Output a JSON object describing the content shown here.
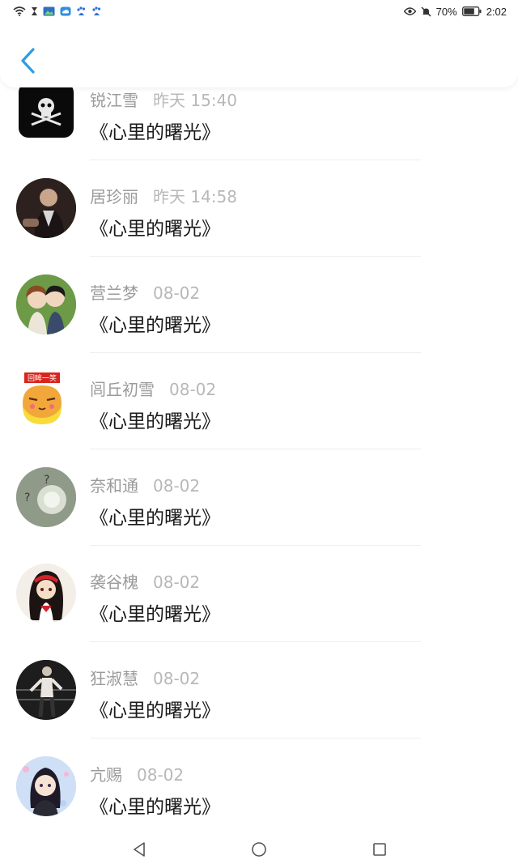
{
  "status_bar": {
    "battery_percent": "70%",
    "time": "2:02",
    "icons_left": [
      "wifi-icon",
      "hourglass-icon",
      "image-icon",
      "cloud-icon",
      "baidu-icon",
      "baidu-icon"
    ],
    "icons_right": [
      "eye-icon",
      "mute-bell-icon",
      "battery-icon"
    ]
  },
  "header": {
    "back_icon": "chevron-left-icon",
    "accent_color": "#2d9ce6"
  },
  "messages": [
    {
      "name": "锐江雪",
      "time": "昨天 15:40",
      "text": "《心里的曙光》"
    },
    {
      "name": "居珍丽",
      "time": "昨天 14:58",
      "text": "《心里的曙光》"
    },
    {
      "name": "营兰梦",
      "time": "08-02",
      "text": "《心里的曙光》"
    },
    {
      "name": "闾丘初雪",
      "time": "08-02",
      "text": "《心里的曙光》"
    },
    {
      "name": "奈和通",
      "time": "08-02",
      "text": "《心里的曙光》"
    },
    {
      "name": "袭谷槐",
      "time": "08-02",
      "text": "《心里的曙光》"
    },
    {
      "name": "狂淑慧",
      "time": "08-02",
      "text": "《心里的曙光》"
    },
    {
      "name": "亢赐",
      "time": "08-02",
      "text": "《心里的曙光》"
    }
  ],
  "avatar_badge_text": "回眸一笑",
  "nav_bar": {
    "icons": [
      "back-triangle-icon",
      "home-circle-icon",
      "recents-square-icon"
    ]
  }
}
